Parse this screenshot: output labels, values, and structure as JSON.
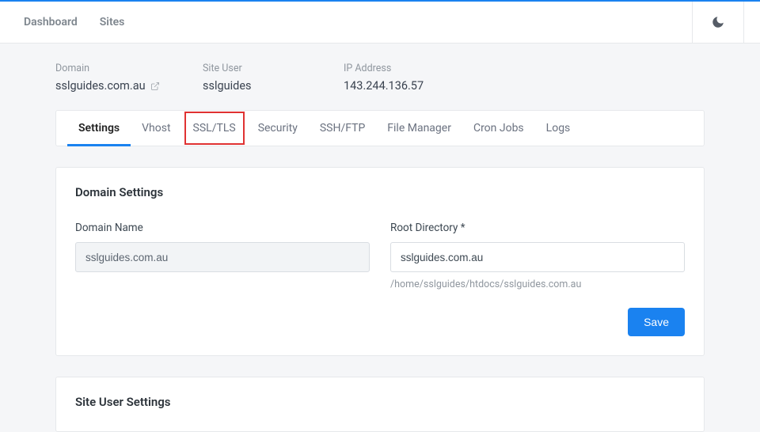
{
  "nav": {
    "dashboard": "Dashboard",
    "sites": "Sites"
  },
  "info": {
    "domain_label": "Domain",
    "domain_value": "sslguides.com.au",
    "siteuser_label": "Site User",
    "siteuser_value": "sslguides",
    "ip_label": "IP Address",
    "ip_value": "143.244.136.57"
  },
  "tabs": {
    "settings": "Settings",
    "vhost": "Vhost",
    "ssl": "SSL/TLS",
    "security": "Security",
    "sshftp": "SSH/FTP",
    "filemanager": "File Manager",
    "cronjobs": "Cron Jobs",
    "logs": "Logs"
  },
  "domain_settings": {
    "title": "Domain Settings",
    "domain_name_label": "Domain Name",
    "domain_name_value": "sslguides.com.au",
    "root_dir_label": "Root Directory *",
    "root_dir_value": "sslguides.com.au",
    "root_dir_hint": "/home/sslguides/htdocs/sslguides.com.au",
    "save_label": "Save"
  },
  "site_user_settings": {
    "title": "Site User Settings"
  }
}
